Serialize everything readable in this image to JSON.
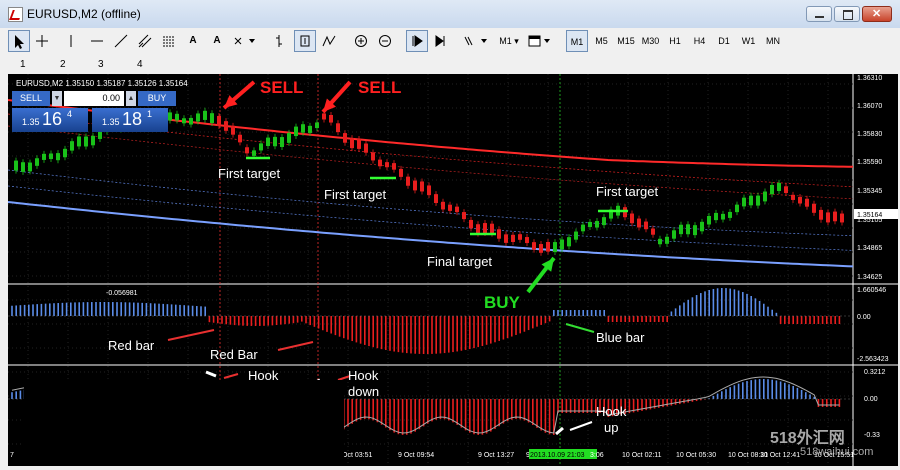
{
  "window": {
    "title": "EURUSD,M2 (offline)"
  },
  "toolbar": {
    "timeframes": [
      "M1",
      "M5",
      "M15",
      "M30",
      "H1",
      "H4",
      "D1",
      "W1",
      "MN"
    ],
    "active_timeframe": "M1",
    "letter_tool_1": "A",
    "letter_tool_2": "A",
    "tf_button_label": "M1",
    "numbers": [
      "1",
      "2",
      "3",
      "4"
    ]
  },
  "chart": {
    "header": "EURUSD,M2  1.35150 1.35187 1.35126 1.35164",
    "price_axis": [
      "1.36310",
      "1.36070",
      "1.35830",
      "1.35590",
      "1.35345",
      "1.35105",
      "1.34865",
      "1.34625"
    ],
    "current_price": "1.35164",
    "ind1_axis": [
      "1.660546",
      "0.00",
      "-2.563423"
    ],
    "ind1_value_label": "-0.056981",
    "ind2_axis": [
      "0.3212",
      "0.00",
      "-0.33"
    ],
    "time_labels": [
      "7",
      "Oct 03:51",
      "9 Oct 09:54",
      "9 Oct 13:27",
      "9 Oct",
      "2013.10.09 21:03",
      "3:06",
      "10 Oct 02:11",
      "10 Oct 05:30",
      "10 Oct 08:31",
      "10 Oct 12:41",
      "10 Oct 15:51"
    ]
  },
  "trade_panel": {
    "sell_label": "SELL",
    "buy_label": "BUY",
    "lot": "0.00",
    "bid_prefix": "1.35",
    "bid_big": "16",
    "bid_sup": "4",
    "ask_prefix": "1.35",
    "ask_big": "18",
    "ask_sup": "1"
  },
  "annotations": {
    "sell_1": "SELL",
    "sell_2": "SELL",
    "buy": "BUY",
    "first_target_1": "First target",
    "first_target_2": "First target",
    "first_target_3": "First target",
    "final_target": "Final target",
    "red_bar_1": "Red bar",
    "red_bar_2": "Red Bar",
    "blue_bar": "Blue bar",
    "hook_down_1_a": "Hook",
    "hook_down_1_b": "down",
    "hook_down_2_a": "Hook",
    "hook_down_2_b": "down",
    "hook_up_a": "Hook",
    "hook_up_b": "up"
  },
  "watermark": {
    "line1": "518外汇网",
    "line2": "518waihui.com"
  },
  "colors": {
    "bull": "#19c219",
    "bear": "#e81e1e",
    "blue": "#5b8ce8",
    "arrow_red": "#ff2020",
    "arrow_green": "#22dd22"
  }
}
